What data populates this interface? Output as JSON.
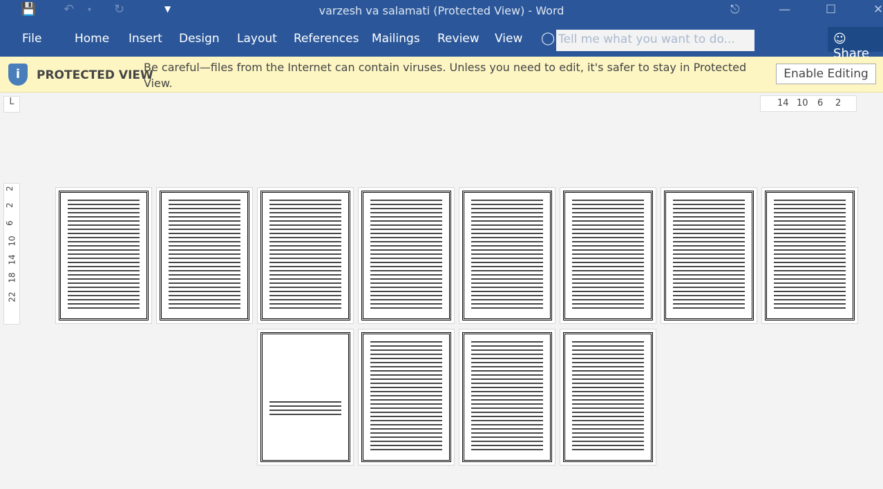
{
  "window": {
    "title": "varzesh va salamati (Protected View) - Word"
  },
  "quick_access": {
    "save": "save-icon",
    "undo": "undo-icon",
    "redo": "redo-icon",
    "customize": "customize-icon"
  },
  "ribbon": {
    "tabs": [
      "File",
      "Home",
      "Insert",
      "Design",
      "Layout",
      "References",
      "Mailings",
      "Review",
      "View"
    ],
    "tell_me_placeholder": "Tell me what you want to do...",
    "share": "Share"
  },
  "protected_view": {
    "label": "PROTECTED VIEW",
    "message": "Be careful—files from the Internet can contain viruses. Unless you need to edit, it's safer to stay in Protected View.",
    "button": "Enable Editing"
  },
  "ruler": {
    "corner": "L",
    "horizontal": [
      "14",
      "10",
      "6",
      "2"
    ],
    "vertical": [
      "2",
      "2",
      "6",
      "10",
      "14",
      "18",
      "22"
    ]
  },
  "document": {
    "page_count": 12,
    "blank_like_page": 9
  },
  "colors": {
    "ribbon": "#2b579a",
    "banner": "#fdf6c3"
  }
}
